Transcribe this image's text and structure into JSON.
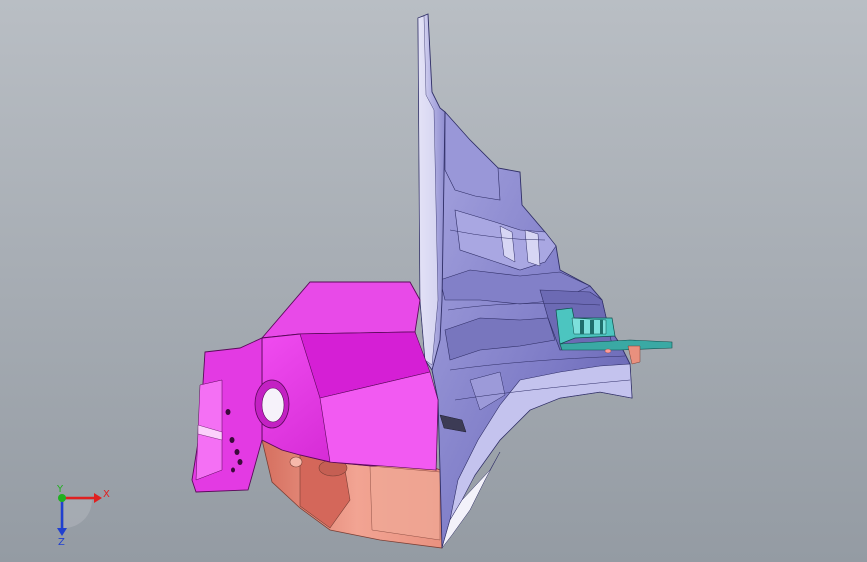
{
  "viewport": {
    "background_top": "#b9bec4",
    "background_bottom": "#949ba3"
  },
  "model": {
    "colors": {
      "magenta_part": "#e62be6",
      "magenta_dark": "#b314b3",
      "purple_part": "#8a88cf",
      "purple_dark": "#5b5aa3",
      "purple_light": "#c6c5ee",
      "salmon_part": "#e9907e",
      "salmon_dark": "#b9685a",
      "teal_part": "#4cc5c0",
      "white_edge": "#f3f2fa"
    }
  },
  "triad": {
    "x_label": "X",
    "y_label": "Y",
    "z_label": "Z",
    "x_color": "#e02020",
    "y_color": "#20b020",
    "z_color": "#2040d0"
  }
}
